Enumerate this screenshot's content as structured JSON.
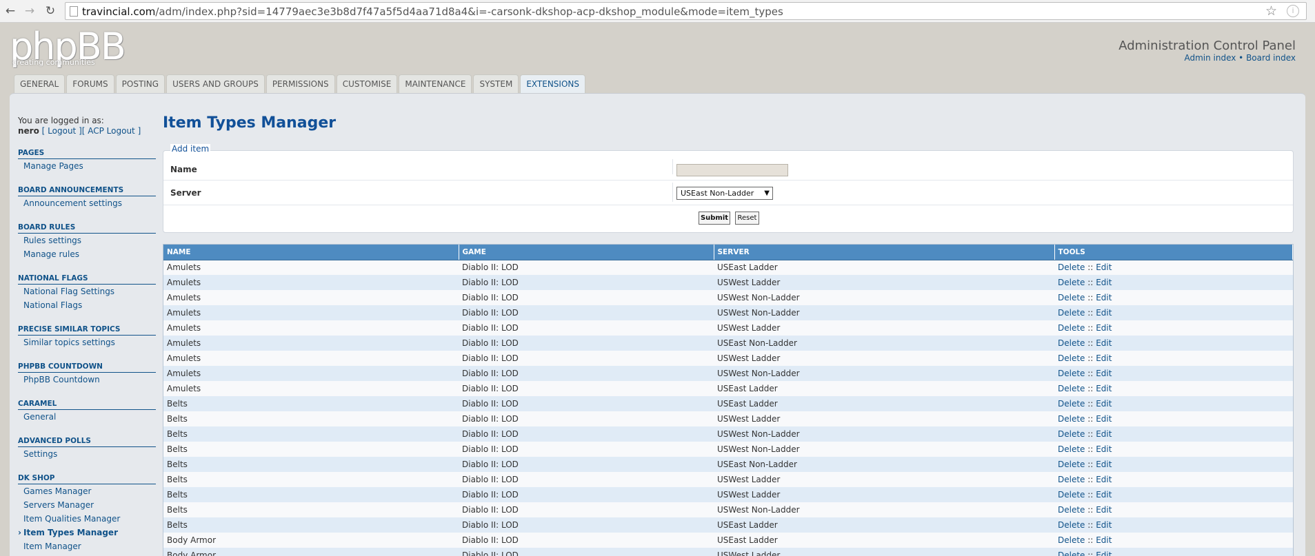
{
  "browser": {
    "url_host": "travincial.com",
    "url_path": "/adm/index.php?sid=14779aec3e3b8d7f47a5f5d4aa71d8a4&i=-carsonk-dkshop-acp-dkshop_module&mode=item_types"
  },
  "header": {
    "logo_text": "phpBB",
    "logo_sub": "creating communities",
    "acp_title": "Administration Control Panel",
    "admin_index": "Admin index",
    "separator": "•",
    "board_index": "Board index"
  },
  "tabs": [
    {
      "label": "General"
    },
    {
      "label": "Forums"
    },
    {
      "label": "Posting"
    },
    {
      "label": "Users and Groups"
    },
    {
      "label": "Permissions"
    },
    {
      "label": "Customise"
    },
    {
      "label": "Maintenance"
    },
    {
      "label": "System"
    },
    {
      "label": "Extensions"
    }
  ],
  "sidebar": {
    "logged_in_label": "You are logged in as:",
    "username": "nero",
    "logout": "[ Logout ]",
    "acp_logout": "[ ACP Logout ]",
    "sections": [
      {
        "title": "Pages",
        "items": [
          "Manage Pages"
        ]
      },
      {
        "title": "Board Announcements",
        "items": [
          "Announcement settings"
        ]
      },
      {
        "title": "Board Rules",
        "items": [
          "Rules settings",
          "Manage rules"
        ]
      },
      {
        "title": "National Flags",
        "items": [
          "National Flag Settings",
          "National Flags"
        ]
      },
      {
        "title": "Precise Similar Topics",
        "items": [
          "Similar topics settings"
        ]
      },
      {
        "title": "phpBB Countdown",
        "items": [
          "PhpBB Countdown"
        ]
      },
      {
        "title": "Caramel",
        "items": [
          "General"
        ]
      },
      {
        "title": "Advanced Polls",
        "items": [
          "Settings"
        ]
      },
      {
        "title": "DK Shop",
        "items": [
          "Games Manager",
          "Servers Manager",
          "Item Qualities Manager",
          "Item Types Manager",
          "Item Manager"
        ]
      }
    ]
  },
  "main": {
    "title": "Item Types Manager",
    "form": {
      "legend": "Add item",
      "name_label": "Name",
      "name_value": "",
      "server_label": "Server",
      "server_selected": "USEast Non-Ladder",
      "submit": "Submit",
      "reset": "Reset"
    },
    "table": {
      "headers": [
        "Name",
        "Game",
        "Server",
        "Tools"
      ],
      "delete": "Delete",
      "sep": "::",
      "edit": "Edit",
      "rows": [
        {
          "name": "Amulets",
          "game": "Diablo II: LOD",
          "server": "USEast Ladder"
        },
        {
          "name": "Amulets",
          "game": "Diablo II: LOD",
          "server": "USWest Ladder"
        },
        {
          "name": "Amulets",
          "game": "Diablo II: LOD",
          "server": "USWest Non-Ladder"
        },
        {
          "name": "Amulets",
          "game": "Diablo II: LOD",
          "server": "USWest Non-Ladder"
        },
        {
          "name": "Amulets",
          "game": "Diablo II: LOD",
          "server": "USWest Ladder"
        },
        {
          "name": "Amulets",
          "game": "Diablo II: LOD",
          "server": "USEast Non-Ladder"
        },
        {
          "name": "Amulets",
          "game": "Diablo II: LOD",
          "server": "USWest Ladder"
        },
        {
          "name": "Amulets",
          "game": "Diablo II: LOD",
          "server": "USWest Non-Ladder"
        },
        {
          "name": "Amulets",
          "game": "Diablo II: LOD",
          "server": "USEast Ladder"
        },
        {
          "name": "Belts",
          "game": "Diablo II: LOD",
          "server": "USEast Ladder"
        },
        {
          "name": "Belts",
          "game": "Diablo II: LOD",
          "server": "USWest Ladder"
        },
        {
          "name": "Belts",
          "game": "Diablo II: LOD",
          "server": "USWest Non-Ladder"
        },
        {
          "name": "Belts",
          "game": "Diablo II: LOD",
          "server": "USWest Non-Ladder"
        },
        {
          "name": "Belts",
          "game": "Diablo II: LOD",
          "server": "USEast Non-Ladder"
        },
        {
          "name": "Belts",
          "game": "Diablo II: LOD",
          "server": "USWest Ladder"
        },
        {
          "name": "Belts",
          "game": "Diablo II: LOD",
          "server": "USWest Ladder"
        },
        {
          "name": "Belts",
          "game": "Diablo II: LOD",
          "server": "USWest Non-Ladder"
        },
        {
          "name": "Belts",
          "game": "Diablo II: LOD",
          "server": "USEast Ladder"
        },
        {
          "name": "Body Armor",
          "game": "Diablo II: LOD",
          "server": "USEast Ladder"
        },
        {
          "name": "Body Armor",
          "game": "Diablo II: LOD",
          "server": "USWest Ladder"
        }
      ]
    }
  }
}
